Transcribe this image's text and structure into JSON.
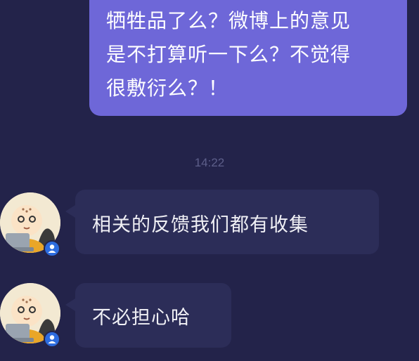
{
  "chat": {
    "outgoing": {
      "lines": [
        "牺牲品了么？微博上的意见",
        "是不打算听一下么？不觉得",
        "很敷衍么？！"
      ]
    },
    "timestamp": "14:22",
    "incoming": [
      {
        "avatar_icon": "monk-avatar-icon",
        "badge_icon": "user-badge-icon",
        "text": "相关的反馈我们都有收集"
      },
      {
        "avatar_icon": "monk-avatar-icon",
        "badge_icon": "user-badge-icon",
        "text": "不必担心哈"
      }
    ]
  },
  "colors": {
    "background": "#23234a",
    "outgoing_bubble": "#6e67d8",
    "incoming_bubble": "#2c2d58",
    "timestamp": "#5d5f8a",
    "badge": "#2d6cdf"
  }
}
